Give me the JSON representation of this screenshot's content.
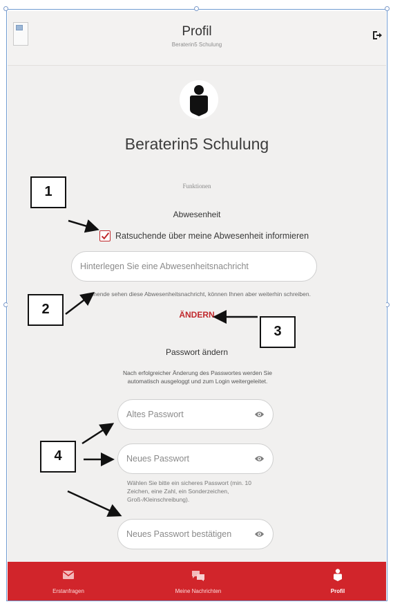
{
  "header": {
    "title": "Profil",
    "subtitle": "Beraterin5 Schulung",
    "logout_icon": "logout-icon"
  },
  "profile": {
    "avatar_icon": "user-avatar-icon",
    "name": "Beraterin5 Schulung"
  },
  "functions": {
    "section_label": "Funktionen",
    "absence": {
      "title": "Abwesenheit",
      "checkbox_label": "Ratsuchende über meine Abwesenheit informieren",
      "checked": true,
      "message_placeholder": "Hinterlegen Sie eine Abwesenheitsnachricht",
      "hint": "chende sehen diese Abwesenheitsnachricht, können Ihnen aber weiterhin schreiben.",
      "change_label": "ÄNDERN"
    }
  },
  "password": {
    "title": "Passwort ändern",
    "hint_line1": "Nach erfolgreicher Änderung des Passwortes werden Sie",
    "hint_line2": "automatisch ausgeloggt und zum Login weitergeleitet.",
    "old_placeholder": "Altes Passwort",
    "new_placeholder": "Neues Passwort",
    "rules_line1": "Wählen Sie bitte ein sicheres Passwort (min. 10",
    "rules_line2": "Zeichen, eine Zahl, ein Sonderzeichen,",
    "rules_line3": "Groß-/Kleinschreibung).",
    "confirm_placeholder": "Neues Passwort bestätigen"
  },
  "annotations": [
    "1",
    "2",
    "3",
    "4"
  ],
  "nav": {
    "items": [
      {
        "label": "Erstanfragen",
        "icon": "envelope-icon"
      },
      {
        "label": "Meine Nachrichten",
        "icon": "chat-bubbles-icon"
      },
      {
        "label": "Profil",
        "icon": "profile-icon",
        "active": true
      }
    ]
  },
  "colors": {
    "accent": "#d1252b",
    "background": "#f1f0ef",
    "text": "#333333"
  }
}
